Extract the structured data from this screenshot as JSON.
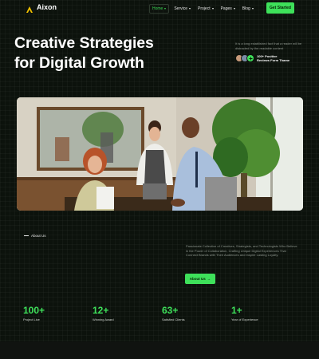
{
  "brand": {
    "name": "Aixon",
    "accent": "#3ee05a",
    "background": "#0c120c"
  },
  "nav": {
    "items": [
      {
        "label": "Home",
        "active": true
      },
      {
        "label": "Service",
        "active": false
      },
      {
        "label": "Project",
        "active": false
      },
      {
        "label": "Pages",
        "active": false
      },
      {
        "label": "Blog",
        "active": false
      }
    ],
    "cta_label": "Get Started"
  },
  "hero": {
    "title_line1": "Creative Strategies",
    "title_line2": "for Digital Growth",
    "description": "It is a long established fact that a reader will be distracted by the readable content",
    "reviews_count_label": "100+ Positive",
    "reviews_source_label": "Reviews Form Thame"
  },
  "photo": {
    "subject": "office-meeting-photo"
  },
  "about": {
    "label": "About Us",
    "description": "Passionate Collective of Creatives, Strategists, and Technologists Who Believe in the Power of Collaboration, Crafting Unique Digital Experiences That Connect Brands with Their Audiences and Inspire Lasting Loyalty.",
    "button_label": "About Us",
    "button_arrow": "→"
  },
  "stats": [
    {
      "value": "100+",
      "label": "Project Live"
    },
    {
      "value": "12+",
      "label": "Winning Award"
    },
    {
      "value": "63+",
      "label": "Satisfied Clients"
    },
    {
      "value": "1+",
      "label": "Year of Experience"
    }
  ]
}
